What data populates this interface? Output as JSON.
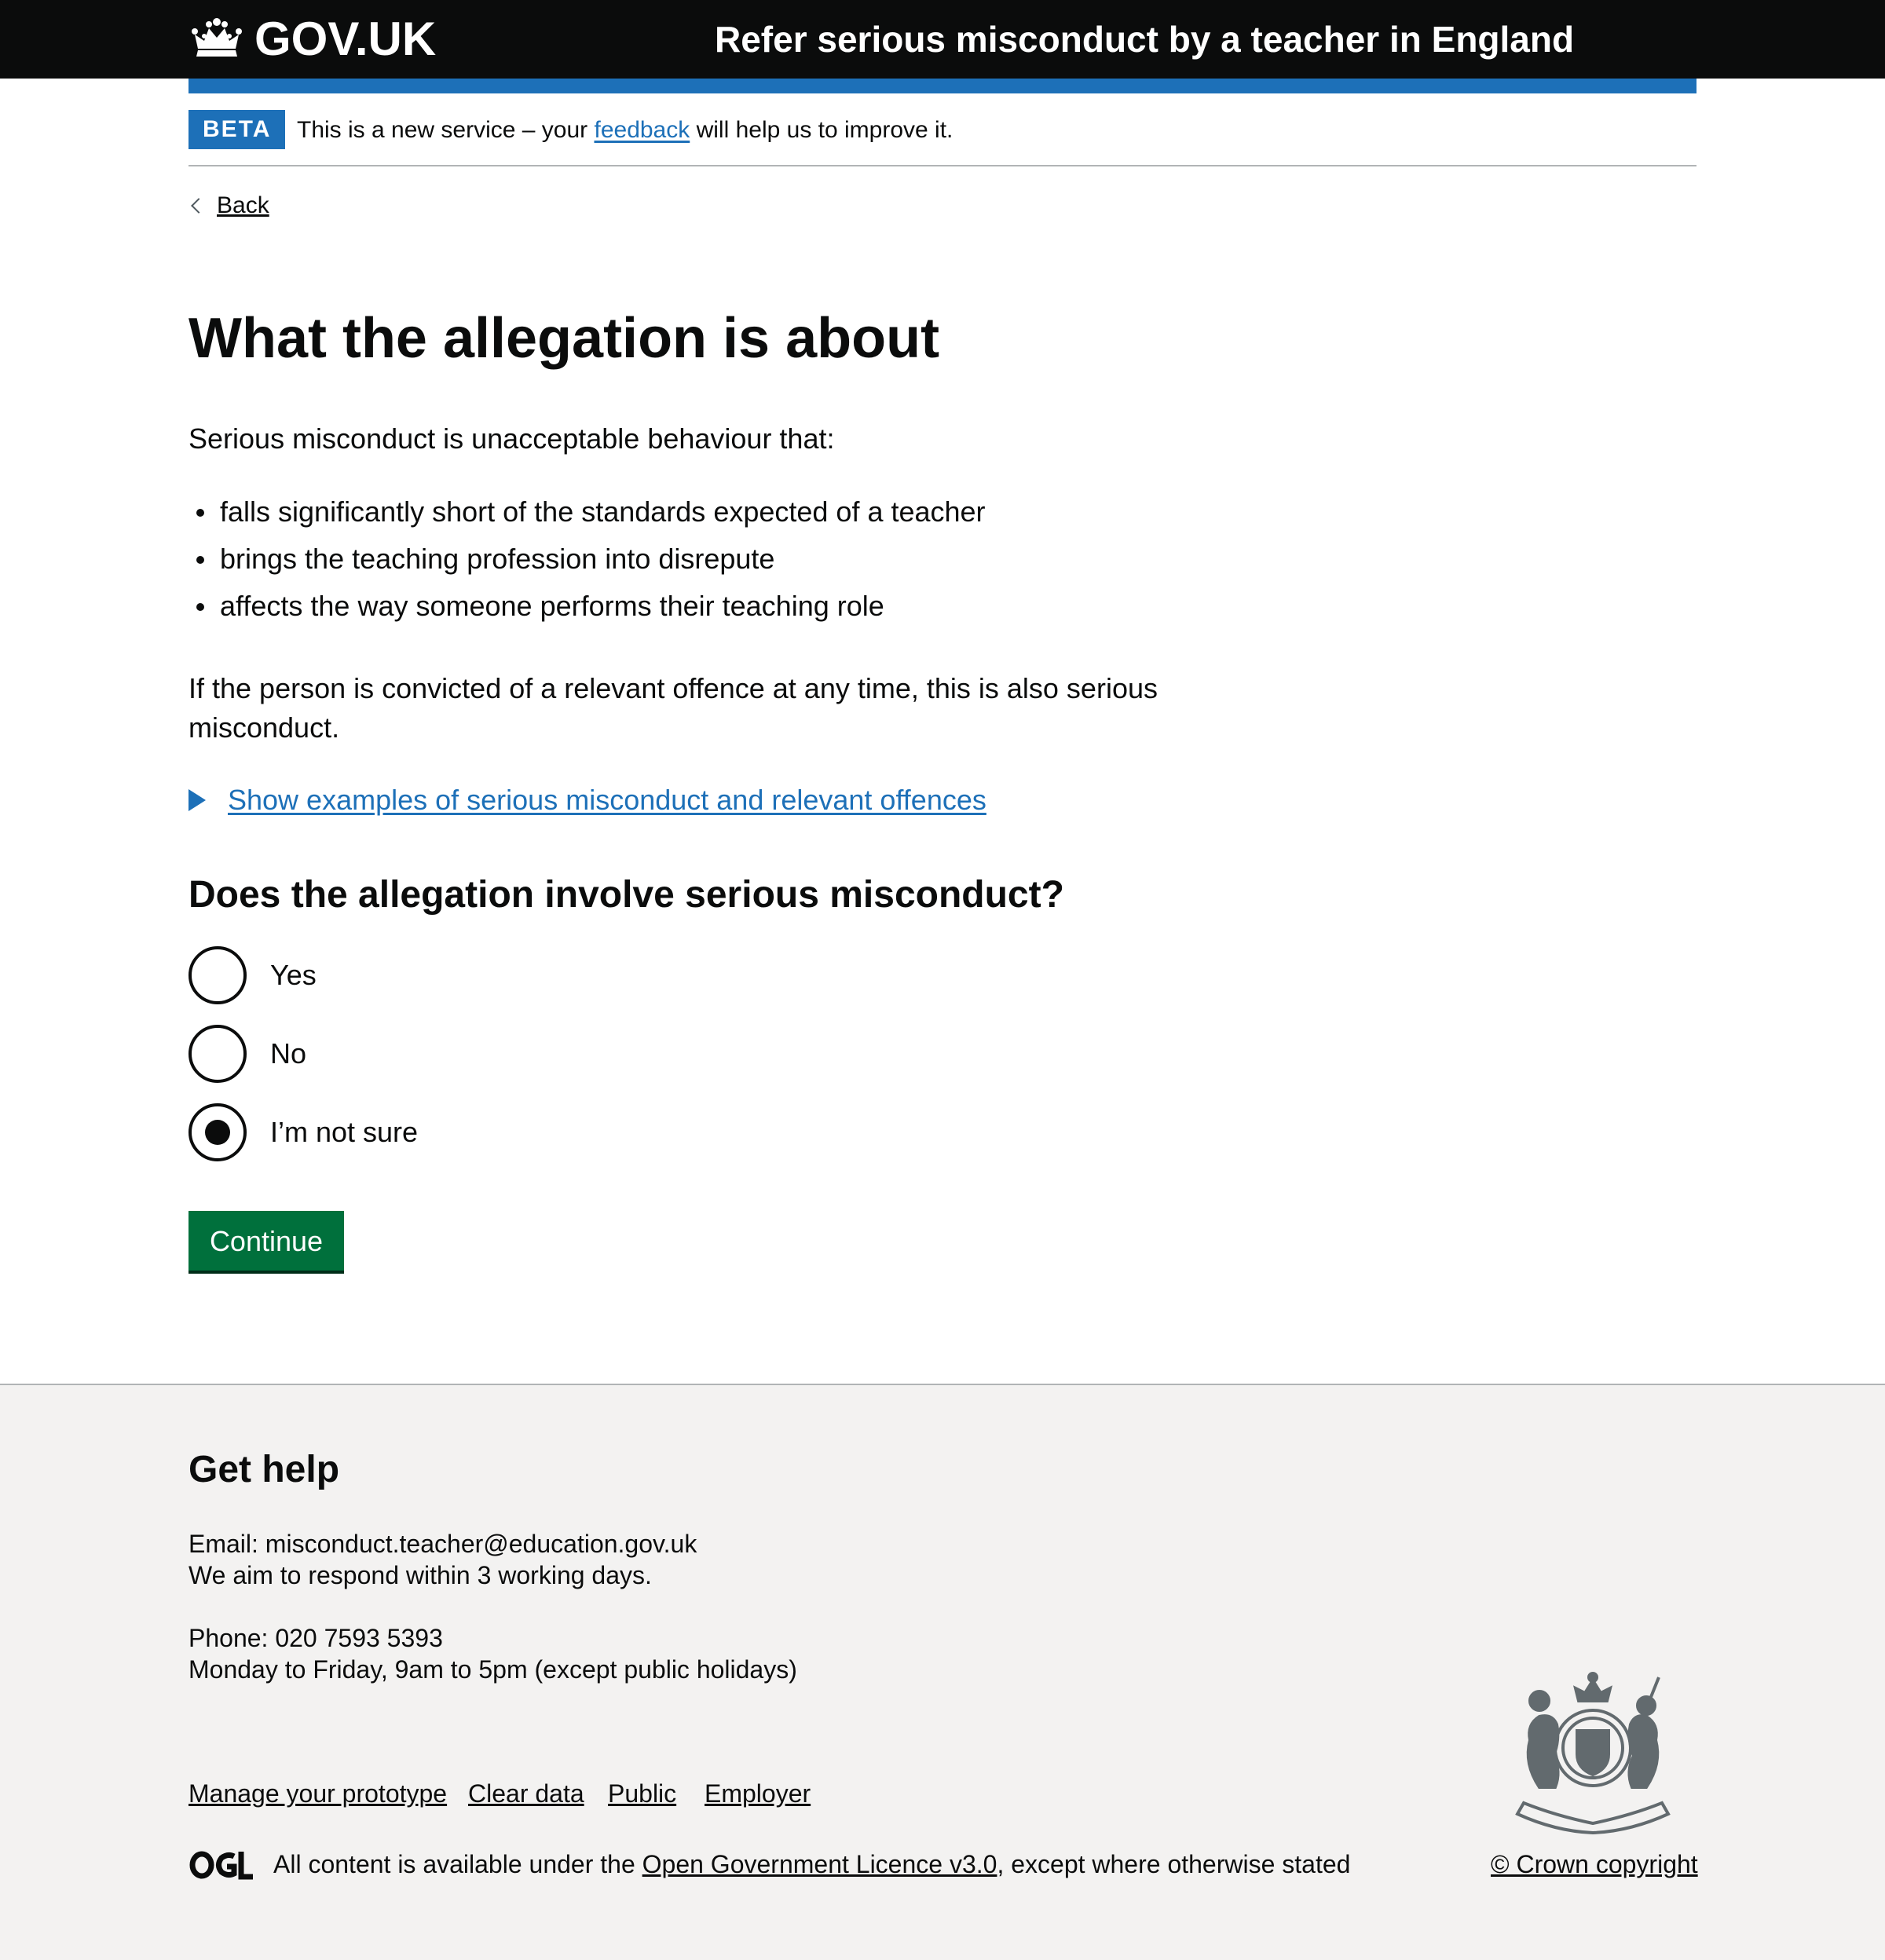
{
  "header": {
    "logo_text": "GOV.UK",
    "service_name": "Refer serious misconduct by a teacher in England"
  },
  "phase_banner": {
    "tag": "BETA",
    "text_before": "This is a new service – your ",
    "link": "feedback",
    "text_after": " will help us to improve it."
  },
  "back_link": "Back",
  "main": {
    "heading": "What the allegation is about",
    "lead": "Serious misconduct is unacceptable behaviour that:",
    "bullets": [
      "falls significantly short of the standards expected of a teacher",
      "brings the teaching profession into disrepute",
      "affects the way someone performs their teaching role"
    ],
    "conviction_text": "If the person is convicted of a relevant offence at any time, this is also serious misconduct.",
    "details_summary": "Show examples of serious misconduct and relevant offences",
    "question": "Does the allegation involve serious misconduct?",
    "options": [
      "Yes",
      "No",
      "I’m not sure"
    ],
    "selected_option": "I’m not sure",
    "continue_button": "Continue"
  },
  "footer": {
    "title": "Get help",
    "email_line": "Email: misconduct.teacher@education.gov.uk",
    "email_note": "We aim to respond within 3 working days.",
    "phone_line": "Phone: 020 7593 5393",
    "phone_note": "Monday to Friday, 9am to 5pm (except public holidays)",
    "links": [
      "Manage your prototype",
      "Clear data",
      "Public",
      "Employer"
    ],
    "ogl_logo": "OGL",
    "licence_before": "All content is available under the ",
    "licence_link": "Open Government Licence v3.0",
    "licence_after": ", except where otherwise stated",
    "copyright": "© Crown copyright"
  },
  "colors": {
    "header_bg": "#0b0c0c",
    "brand_blue": "#1d70b8",
    "button_green": "#00703c",
    "footer_bg": "#f3f2f1"
  }
}
